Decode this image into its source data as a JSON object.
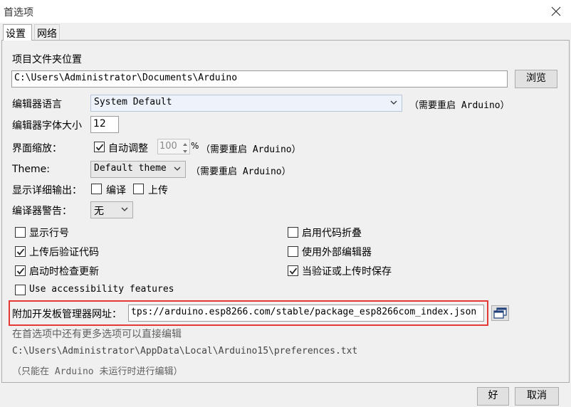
{
  "window": {
    "title": "首选项"
  },
  "tabs": [
    {
      "label": "设置"
    },
    {
      "label": "网络"
    }
  ],
  "settings": {
    "sketchbook_label": "项目文件夹位置",
    "sketchbook_path": "C:\\Users\\Administrator\\Documents\\Arduino",
    "browse_label": "浏览",
    "language_label": "编辑器语言",
    "language_value": "System Default",
    "language_note": "（需要重启 Arduino）",
    "font_size_label": "编辑器字体大小",
    "font_size_value": "12",
    "scale_label": "界面缩放：",
    "scale_auto_label": "自动调整",
    "scale_value": "100",
    "scale_unit": "%",
    "scale_note": "（需要重启 Arduino）",
    "theme_label": "Theme:",
    "theme_value": "Default theme",
    "theme_note": "（需要重启 Arduino）",
    "verbose_label": "显示详细输出：",
    "verbose_compile_label": "编译",
    "verbose_upload_label": "上传",
    "warnings_label": "编译器警告：",
    "warnings_value": "无",
    "options": {
      "line_numbers": "显示行号",
      "verify_after_upload": "上传后验证代码",
      "check_updates": "启动时检查更新",
      "accessibility": "Use accessibility features",
      "code_folding": "启用代码折叠",
      "external_editor": "使用外部编辑器",
      "save_on_verify": "当验证或上传时保存"
    },
    "checked": {
      "scale_auto": true,
      "verbose_compile": false,
      "verbose_upload": false,
      "line_numbers": false,
      "verify_after_upload": true,
      "check_updates": true,
      "accessibility": false,
      "code_folding": false,
      "external_editor": false,
      "save_on_verify": true
    },
    "boards_url_label": "附加开发板管理器网址：",
    "boards_url_value": "tps://arduino.esp8266.com/stable/package_esp8266com_index.json",
    "more_prefs_note": "在首选项中还有更多选项可以直接编辑",
    "prefs_path": "C:\\Users\\Administrator\\AppData\\Local\\Arduino15\\preferences.txt",
    "prefs_note": "（只能在 Arduino 未运行时进行编辑）"
  },
  "footer": {
    "ok_label": "好",
    "cancel_label": "取消"
  },
  "colors": {
    "highlight": "#e53935"
  },
  "icons": {
    "close": "close-icon",
    "dropdown": "chevron-down-icon",
    "window_edit": "window-icon",
    "check": "check-icon"
  }
}
